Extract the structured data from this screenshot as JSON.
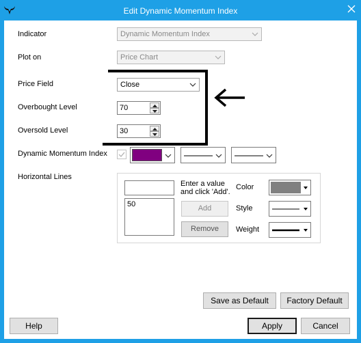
{
  "window": {
    "title": "Edit Dynamic Momentum Index",
    "icon": "bull-horns-icon"
  },
  "form": {
    "indicator_label": "Indicator",
    "indicator_value": "Dynamic Momentum Index",
    "plot_on_label": "Plot on",
    "plot_on_value": "Price Chart",
    "price_field_label": "Price Field",
    "price_field_value": "Close",
    "overbought_label": "Overbought Level",
    "overbought_value": "70",
    "oversold_label": "Oversold Level",
    "oversold_value": "30",
    "series_label": "Dynamic Momentum Index",
    "series_color": "#800080"
  },
  "horizontal_lines": {
    "label": "Horizontal Lines",
    "new_value": "",
    "hint_line1": "Enter a value",
    "hint_line2": "and click 'Add'.",
    "items": [
      "50"
    ],
    "add_label": "Add",
    "remove_label": "Remove",
    "color_label": "Color",
    "color_value": "#808080",
    "style_label": "Style",
    "weight_label": "Weight"
  },
  "buttons": {
    "save_default": "Save as Default",
    "factory_default": "Factory Default",
    "help": "Help",
    "apply": "Apply",
    "cancel": "Cancel"
  },
  "annotation": {
    "color": "#000000",
    "icon": "left-arrow-icon"
  }
}
